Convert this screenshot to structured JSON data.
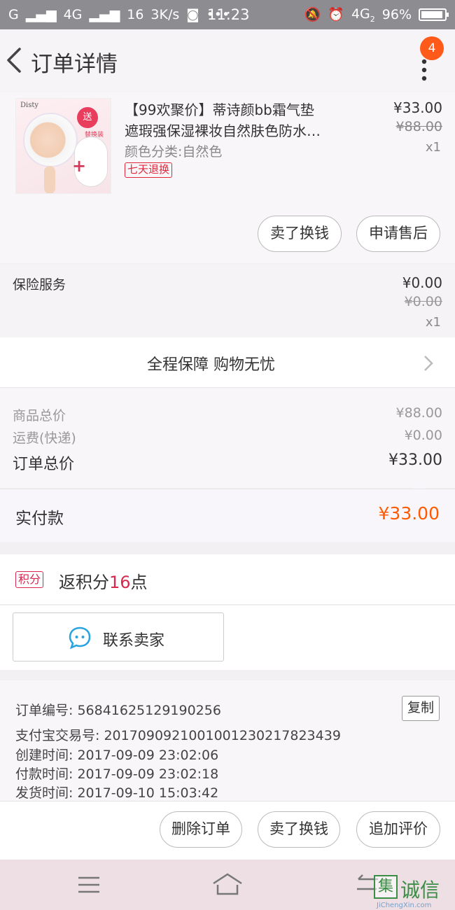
{
  "status_bar": {
    "carrier": "G",
    "network1": "4G",
    "network2": "16",
    "speed": "3K/s",
    "more": "•••",
    "time": "11:23",
    "network3": "4G",
    "sim": "2",
    "battery": "96%"
  },
  "header": {
    "title": "订单详情",
    "badge": "4"
  },
  "product": {
    "title_line1": "【99欢聚价】蒂诗颜bb霜气垫",
    "title_line2": "遮瑕强保湿裸妆自然肤色防水…",
    "spec": "颜色分类:自然色",
    "return_tag": "七天退换",
    "price_now": "¥33.00",
    "price_old": "¥88.00",
    "qty": "x1",
    "image": {
      "brand": "Disty",
      "gift": "送",
      "gift_label": "替换装",
      "plus": "+"
    },
    "actions": [
      "卖了换钱",
      "申请售后"
    ]
  },
  "insurance": {
    "label": "保险服务",
    "price_now": "¥0.00",
    "price_old": "¥0.00",
    "qty": "x1"
  },
  "guarantee": {
    "text": "全程保障 购物无忧"
  },
  "totals": {
    "goods_label": "商品总价",
    "goods_value": "¥88.00",
    "shipping_label": "运费(快递)",
    "shipping_value": "¥0.00",
    "order_label": "订单总价",
    "order_value": "¥33.00"
  },
  "paid": {
    "label": "实付款",
    "value": "¥33.00"
  },
  "points": {
    "tag": "积分",
    "prefix": "返积分",
    "num": "16",
    "suffix": "点"
  },
  "contact": {
    "label": "联系卖家"
  },
  "info": {
    "order_no": "订单编号: 56841625129190256",
    "alipay_no": "支付宝交易号: 2017090921001001230217823439",
    "created": "创建时间: 2017-09-09  23:02:06",
    "paid": "付款时间: 2017-09-09  23:02:18",
    "shipped": "发货时间: 2017-09-10  15:03:42",
    "copy": "复制"
  },
  "bottom_actions": [
    "删除订单",
    "卖了换钱",
    "追加评价"
  ],
  "watermark": {
    "box": "集",
    "text": "诚信",
    "url": "JiChengXin.com"
  },
  "colors": {
    "accent": "#ff5a00",
    "tag_red": "#e0283c",
    "badge": "#ff5a1a"
  }
}
